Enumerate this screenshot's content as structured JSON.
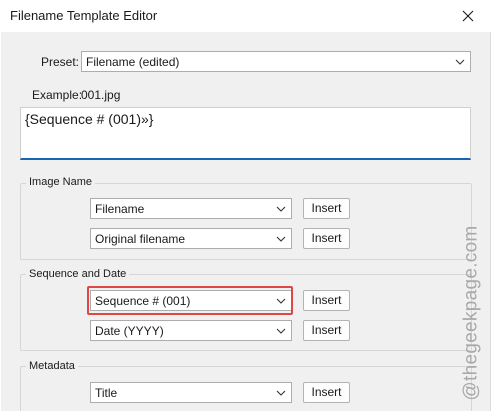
{
  "window": {
    "title": "Filename Template Editor"
  },
  "preset": {
    "label": "Preset:",
    "value": "Filename (edited)"
  },
  "example": {
    "label": "Example:",
    "value": "001.jpg"
  },
  "template_text": "{Sequence # (001)»}",
  "image_name": {
    "title": "Image Name",
    "rows": [
      {
        "select": "Filename",
        "button": "Insert"
      },
      {
        "select": "Original filename",
        "button": "Insert"
      }
    ]
  },
  "sequence_date": {
    "title": "Sequence and Date",
    "rows": [
      {
        "select": "Sequence # (001)",
        "button": "Insert"
      },
      {
        "select": "Date (YYYY)",
        "button": "Insert"
      }
    ]
  },
  "metadata": {
    "title": "Metadata",
    "rows": [
      {
        "select": "Title",
        "button": "Insert"
      }
    ]
  },
  "watermark": "@thegeekpage.com",
  "colors": {
    "accent": "#1a64b4",
    "highlight": "#e04646",
    "dialog_bg": "#f0f0f0"
  }
}
